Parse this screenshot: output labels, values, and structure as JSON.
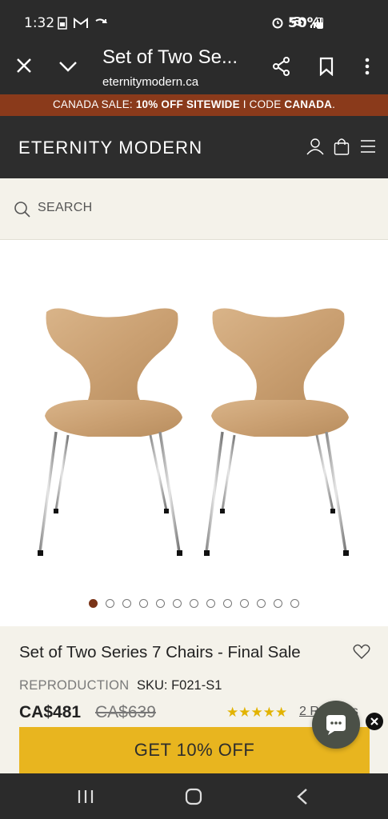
{
  "status_bar": {
    "time": "1:32",
    "battery": "50%"
  },
  "browser": {
    "tab_title": "Set of Two Se...",
    "url": "eternitymodern.ca"
  },
  "promo": {
    "prefix": "CANADA SALE: ",
    "highlight": "10% OFF SITEWIDE",
    "middle": " I CODE ",
    "code": "CANADA",
    "suffix": "."
  },
  "site": {
    "logo": "ETERNITY MODERN"
  },
  "search": {
    "placeholder": "SEARCH"
  },
  "gallery": {
    "dot_count": 13,
    "active_index": 0
  },
  "product": {
    "title": "Set of Two Series 7 Chairs - Final Sale",
    "tag": "REPRODUCTION",
    "sku": "SKU: F021-S1",
    "price": "CA$481",
    "old_price": "CA$639",
    "rating": 5,
    "stars": "★★★★★",
    "reviews": "2 Reviews"
  },
  "cta": {
    "label": "GET 10% OFF"
  },
  "colors": {
    "promo_bg": "#8a3a1b",
    "header_bg": "#2d2d2d",
    "cta_bg": "#e8b51f",
    "star": "#e2b300",
    "active_dot": "#7a3418"
  }
}
